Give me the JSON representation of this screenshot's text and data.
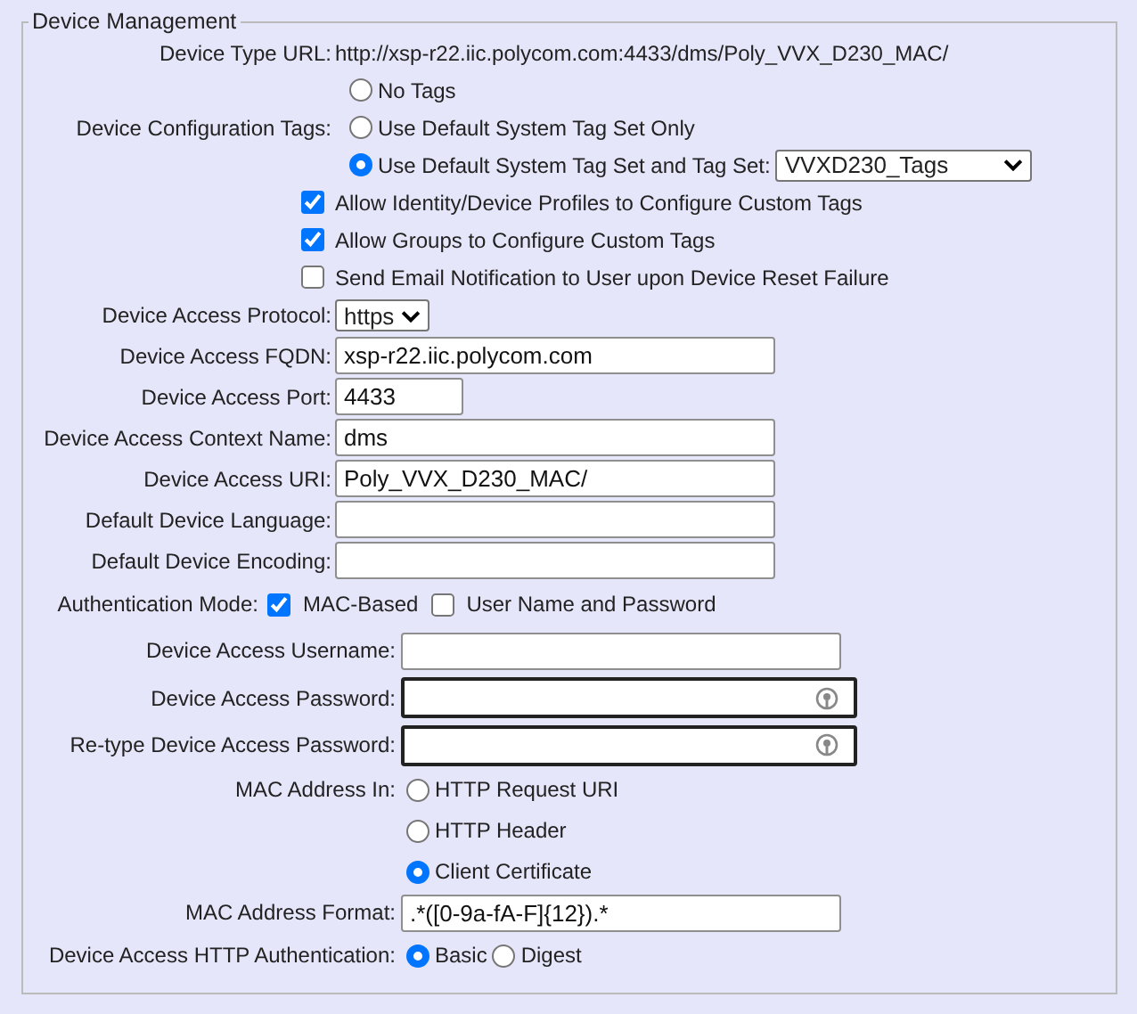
{
  "legend": "Device Management",
  "device_type_url": {
    "label": "Device Type URL:",
    "value": "http://xsp-r22.iic.polycom.com:4433/dms/Poly_VVX_D230_MAC/"
  },
  "config_tags": {
    "label": "Device Configuration Tags:",
    "tag_set": "VVXD230_Tags",
    "options": [
      {
        "label": "No Tags",
        "selected": false
      },
      {
        "label": "Use Default System Tag Set Only",
        "selected": false
      },
      {
        "label": "Use Default System Tag Set and Tag Set:",
        "selected": true
      }
    ]
  },
  "checkboxes": [
    {
      "label": "Allow Identity/Device Profiles to Configure Custom Tags",
      "checked": true
    },
    {
      "label": "Allow Groups to Configure Custom Tags",
      "checked": true
    },
    {
      "label": "Send Email Notification to User upon Device Reset Failure",
      "checked": false
    }
  ],
  "protocol": {
    "label": "Device Access Protocol:",
    "value": "https"
  },
  "fields": [
    {
      "label": "Device Access FQDN:",
      "value": "xsp-r22.iic.polycom.com",
      "kind": "long"
    },
    {
      "label": "Device Access Port:",
      "value": "4433",
      "kind": "short"
    },
    {
      "label": "Device Access Context Name:",
      "value": "dms",
      "kind": "long"
    },
    {
      "label": "Device Access URI:",
      "value": "Poly_VVX_D230_MAC/",
      "kind": "long"
    },
    {
      "label": "Default Device Language:",
      "kind": "long"
    },
    {
      "label": "Default Device Encoding:",
      "kind": "long"
    }
  ],
  "auth_mode": {
    "label": "Authentication Mode:",
    "options": [
      {
        "label": "MAC-Based",
        "checked": true
      },
      {
        "label": "User Name and Password",
        "checked": false
      }
    ]
  },
  "credentials": [
    {
      "label": "Device Access Username:",
      "kind": "text"
    },
    {
      "label": "Device Access Password:",
      "kind": "password"
    },
    {
      "label": "Re-type Device Access Password:",
      "kind": "password"
    }
  ],
  "mac_address_in": {
    "label": "MAC Address In:",
    "options": [
      {
        "label": "HTTP Request URI",
        "selected": false
      },
      {
        "label": "HTTP Header",
        "selected": false
      },
      {
        "label": "Client Certificate",
        "selected": true
      }
    ]
  },
  "mac_format": {
    "label": "MAC Address Format:",
    "value": ".*([0-9a-fA-F]{12}).*"
  },
  "http_auth": {
    "label": "Device Access HTTP Authentication:",
    "options": [
      {
        "label": "Basic",
        "selected": true
      },
      {
        "label": "Digest",
        "selected": false
      }
    ]
  }
}
